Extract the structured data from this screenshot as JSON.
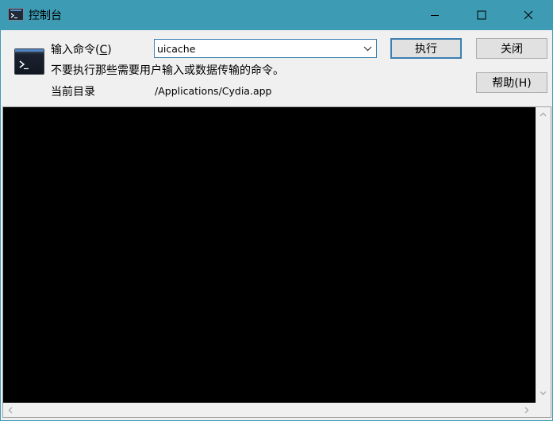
{
  "window": {
    "title": "控制台",
    "icons": {
      "app": "terminal-icon",
      "minimize": "minimize-icon",
      "maximize": "maximize-icon",
      "close": "close-icon"
    }
  },
  "command": {
    "label_text": "输入命令(",
    "label_mnemonic": "C",
    "label_end": ")",
    "value": "uicache",
    "warning": "不要执行那些需要用户输入或数据传输的命令。"
  },
  "directory": {
    "label": "当前目录",
    "value": "/Applications/Cydia.app"
  },
  "buttons": {
    "execute": "执行",
    "close": "关闭",
    "help": "帮助(H)"
  },
  "colors": {
    "titlebar": "#3d9cb4",
    "client": "#f0f0f0",
    "console": "#000000",
    "focus_border": "#3c7fb1"
  }
}
